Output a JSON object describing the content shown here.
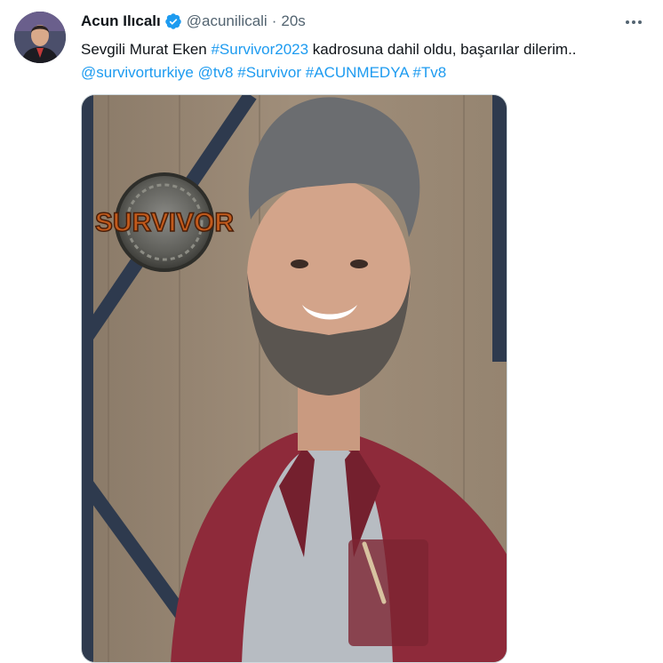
{
  "tweet": {
    "author_name": "Acun Ilıcalı",
    "handle": "@acunilicali",
    "separator": "·",
    "timestamp": "20s",
    "text_part1": "Sevgili Murat Eken ",
    "hashtag1": "#Survivor2023",
    "text_part2": " kadrosuna dahil oldu, başarılar dilerim..",
    "mention1": "@survivorturkiye",
    "mention2": "@tv8",
    "hashtag2": "#Survivor",
    "hashtag3": "#ACUNMEDYA",
    "hashtag4": "#Tv8"
  },
  "media": {
    "logo_text": "SURVIVOR"
  },
  "colors": {
    "link": "#1d9bf0",
    "secondary_text": "#536471",
    "verified_badge": "#1d9bf0",
    "shirt": "#8e2a3a"
  },
  "icons": {
    "verified": "verified-badge-icon",
    "more": "more-options-icon"
  }
}
